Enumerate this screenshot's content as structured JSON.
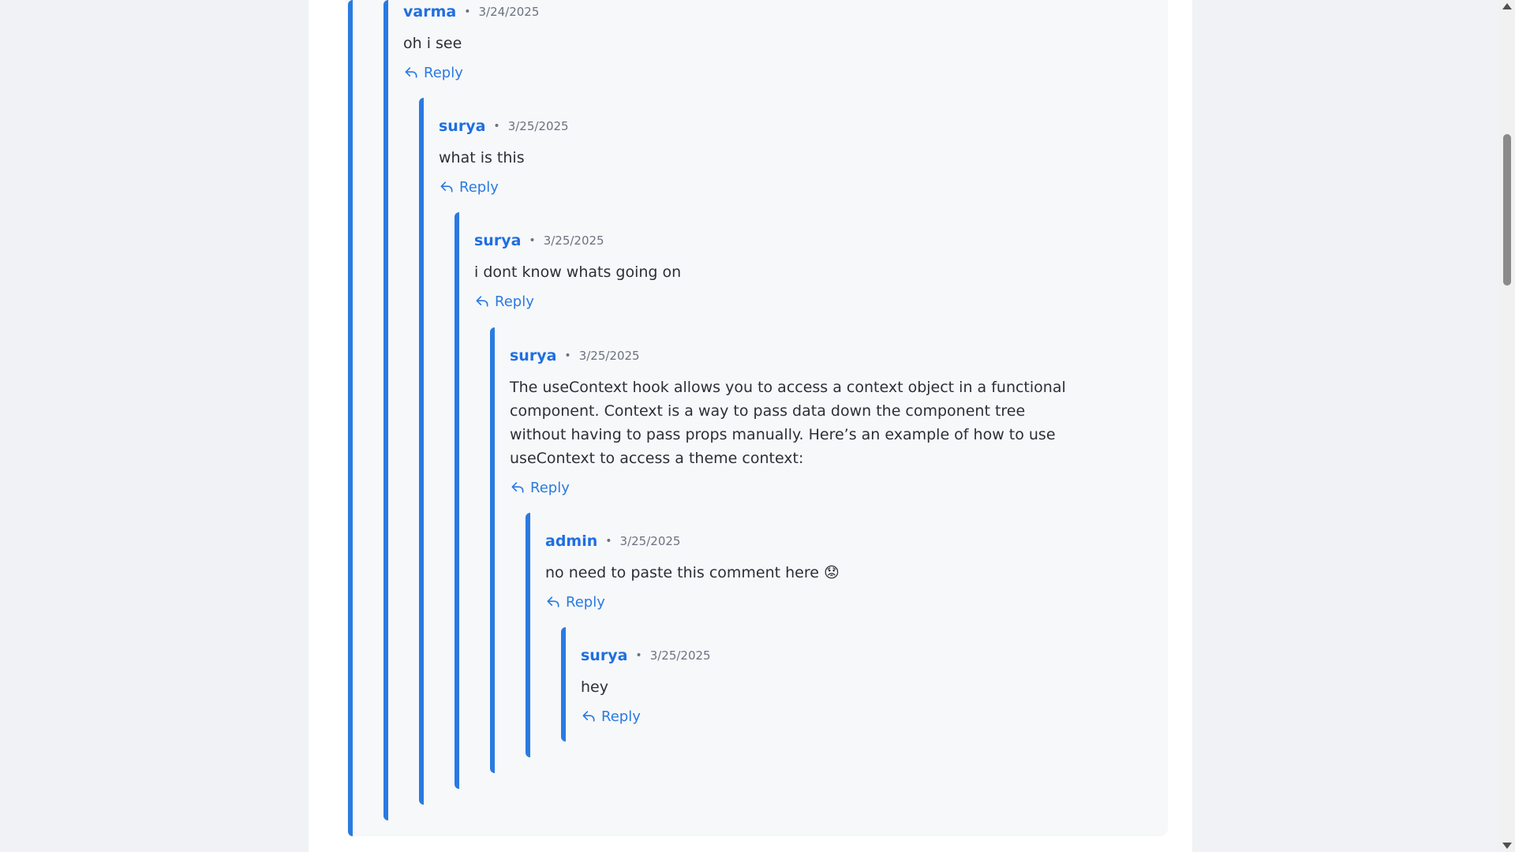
{
  "comments": [
    {
      "author": "varma",
      "date": "3/24/2025",
      "text": "oh i see",
      "reply": "Reply"
    },
    {
      "author": "surya",
      "date": "3/25/2025",
      "text": "what is this",
      "reply": "Reply"
    },
    {
      "author": "surya",
      "date": "3/25/2025",
      "text": "i dont know whats going on",
      "reply": "Reply"
    },
    {
      "author": "surya",
      "date": "3/25/2025",
      "text": "The useContext hook allows you to access a context object in a functional component. Context is a way to pass data down the component tree without having to pass props manually. Here’s an example of how to use useContext to access a theme context:",
      "reply": "Reply"
    },
    {
      "author": "admin",
      "date": "3/25/2025",
      "text": "no need to paste this comment here 😟",
      "reply": "Reply"
    },
    {
      "author": "surya",
      "date": "3/25/2025",
      "text": "hey",
      "reply": "Reply"
    }
  ],
  "separator": "•",
  "colors": {
    "accent": "#2a7ae2",
    "author": "#1f6fe0",
    "text": "#2b2f36",
    "meta": "#6b7280"
  },
  "icons": {
    "reply": "reply-arrow-icon"
  }
}
